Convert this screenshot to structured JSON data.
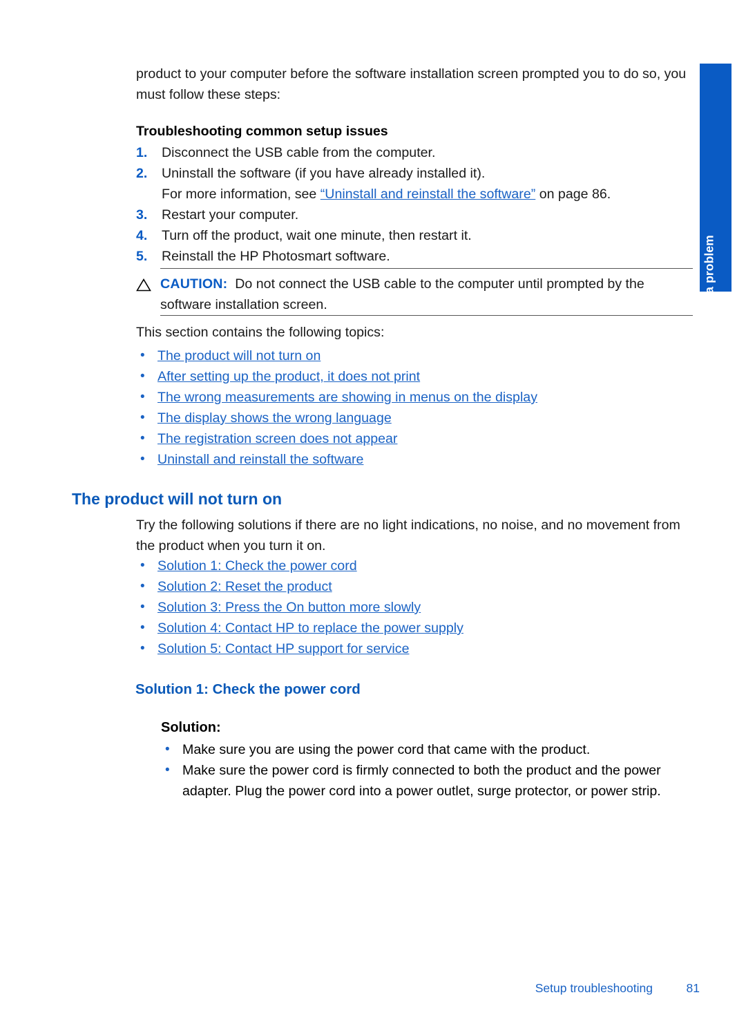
{
  "side_tab": {
    "label": "Solve a problem",
    "color": "#0a5bc4"
  },
  "intro": {
    "paragraph": "product to your computer before the software installation screen prompted you to do so, you must follow these steps:"
  },
  "troubleshooting": {
    "heading": "Troubleshooting common setup issues",
    "steps": [
      {
        "number": "1.",
        "text": "Disconnect the USB cable from the computer."
      },
      {
        "number": "2.",
        "text": "Uninstall the software (if you have already installed it)."
      },
      {
        "number": "3.",
        "text": "Restart your computer."
      },
      {
        "number": "4.",
        "text": "Turn off the product, wait one minute, then restart it."
      },
      {
        "number": "5.",
        "text": "Reinstall the HP Photosmart software."
      }
    ],
    "step2_note_prefix": "For more information, see ",
    "step2_note_link": "“Uninstall and reinstall the software”",
    "step2_note_suffix": " on page 86."
  },
  "caution": {
    "icon": "warning-triangle-icon",
    "label": "CAUTION:",
    "text": "Do not connect the USB cable to the computer until prompted by the software installation screen."
  },
  "topics": {
    "intro": "This section contains the following topics:",
    "links": [
      "The product will not turn on",
      "After setting up the product, it does not print",
      "The wrong measurements are showing in menus on the display",
      "The display shows the wrong language",
      "The registration screen does not appear",
      "Uninstall and reinstall the software"
    ]
  },
  "section": {
    "heading": "The product will not turn on",
    "intro": "Try the following solutions if there are no light indications, no noise, and no movement from the product when you turn it on.",
    "solution_links": [
      "Solution 1: Check the power cord",
      "Solution 2: Reset the product",
      "Solution 3: Press the On button more slowly",
      "Solution 4: Contact HP to replace the power supply",
      "Solution 5: Contact HP support for service"
    ]
  },
  "solution1": {
    "heading": "Solution 1: Check the power cord",
    "label": "Solution:",
    "bullets": [
      "Make sure you are using the power cord that came with the product.",
      "Make sure the power cord is firmly connected to both the product and the power adapter. Plug the power cord into a power outlet, surge protector, or power strip."
    ]
  },
  "footer": {
    "label": "Setup troubleshooting",
    "page": "81"
  },
  "colors": {
    "link": "#1a62c4",
    "heading": "#0a59b8",
    "accent": "#0a5bc4",
    "text": "#1a1a1a"
  },
  "bullet_glyph": "•"
}
